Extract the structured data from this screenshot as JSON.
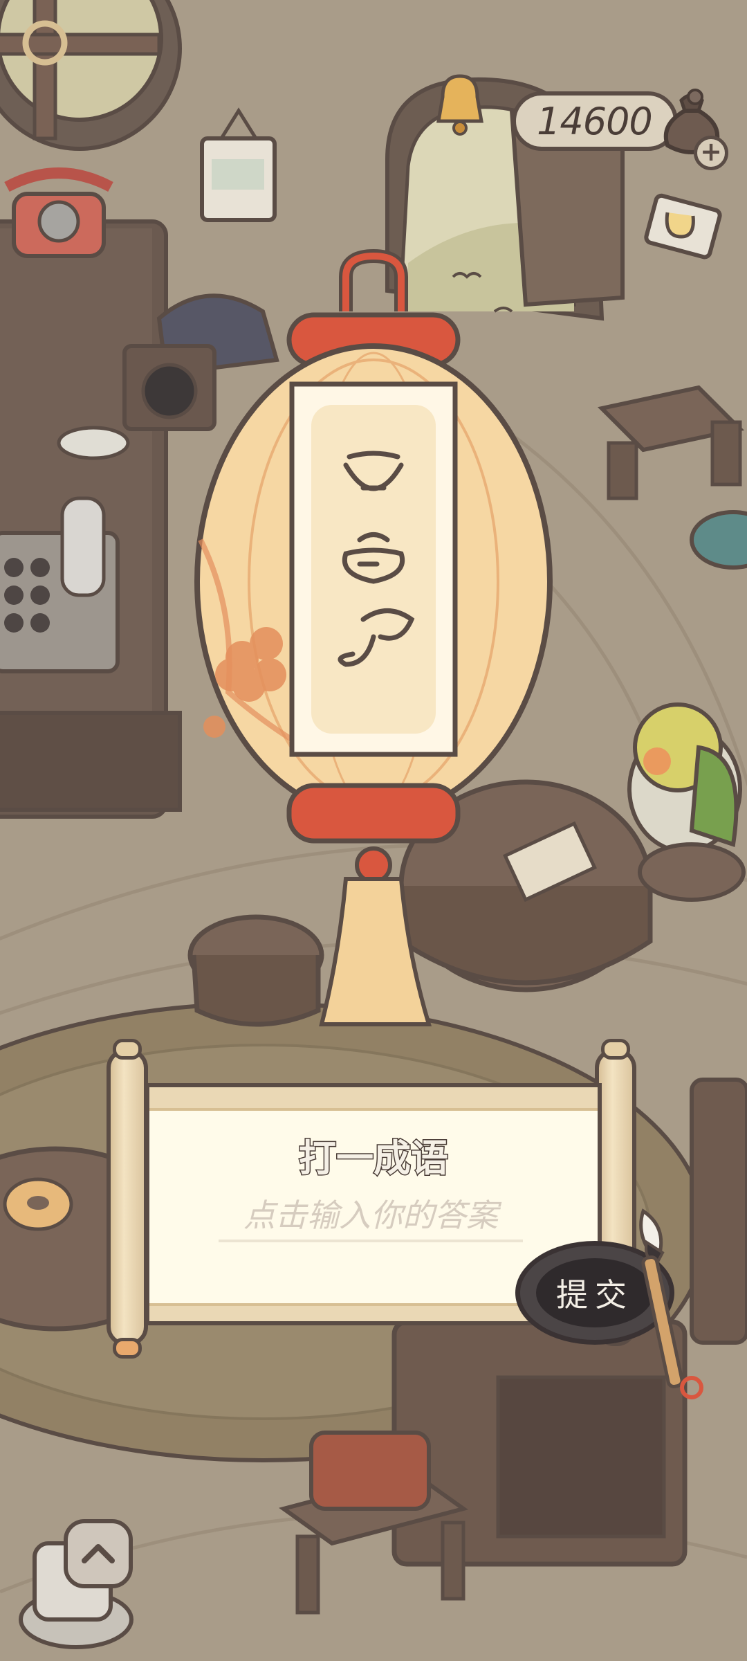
{
  "header": {
    "coins": "14600",
    "add_coins_label": "+"
  },
  "riddle": {
    "title": "打一成语",
    "answer_placeholder": "点击输入你的答案",
    "submit_label": "提交"
  },
  "icons": {
    "coin_bag": "coin-bag-icon",
    "add": "plus-icon",
    "mail": "mail-icon",
    "scroll_up": "chevron-up-icon"
  },
  "colors": {
    "outline": "#5a4c45",
    "paper": "#fffbea",
    "lantern": "#f6d7a3",
    "lantern_cap": "#d9573f",
    "submit": "#2f2a2c"
  }
}
